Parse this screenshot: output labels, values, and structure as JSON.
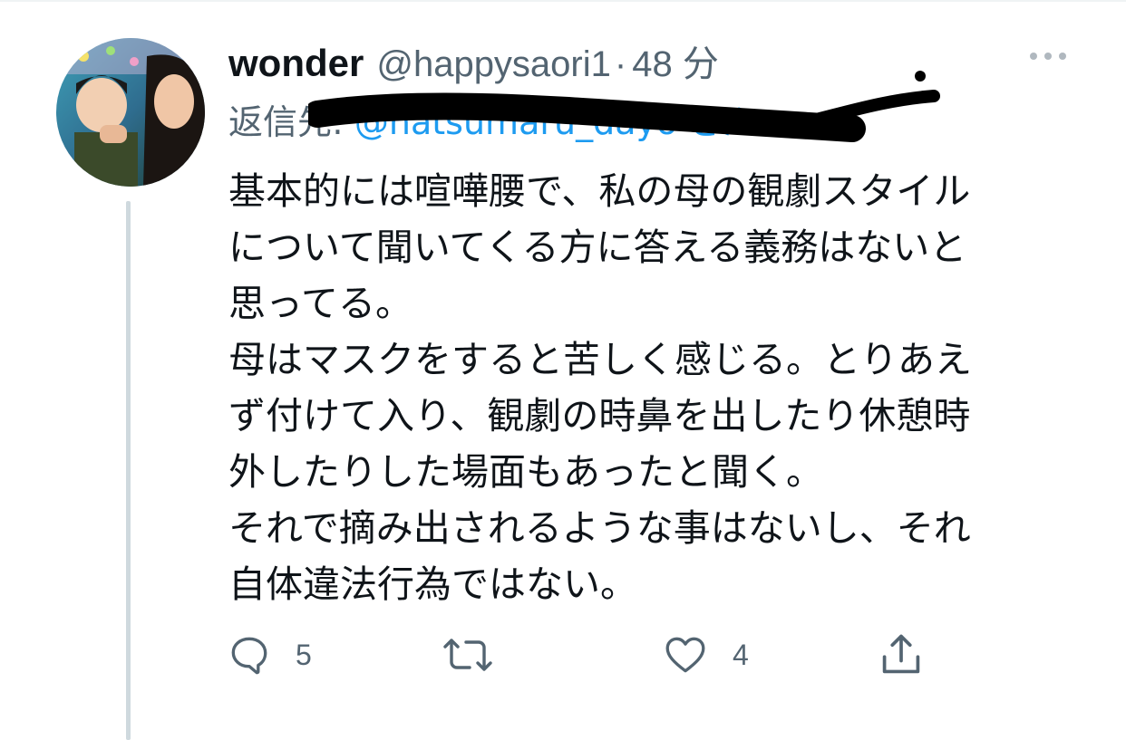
{
  "tweet": {
    "display_name": "wonder",
    "handle": "@happysaori1",
    "separator": "·",
    "time": "48 分",
    "reply_prefix": "返信先:",
    "reply_to": "@natsumaru_dayo さん",
    "body_lines": [
      "基本的には喧嘩腰で、私の母の観劇スタイル",
      "について聞いてくる方に答える義務はないと",
      "思ってる。",
      "母はマスクをすると苦しく感じる。とりあえ",
      "ず付けて入り、観劇の時鼻を出したり休憩時",
      "外したりした場面もあったと聞く。",
      "それで摘み出されるような事はないし、それ",
      "自体違法行為ではない。"
    ]
  },
  "actions": {
    "reply": {
      "icon": "reply-icon",
      "count": "5"
    },
    "retweet": {
      "icon": "retweet-icon",
      "count": ""
    },
    "like": {
      "icon": "heart-icon",
      "count": "4"
    },
    "share": {
      "icon": "share-icon"
    }
  },
  "colors": {
    "text_primary": "#0f1419",
    "text_secondary": "#536471",
    "link": "#1d9bf0",
    "thread_line": "#cfd9de"
  }
}
